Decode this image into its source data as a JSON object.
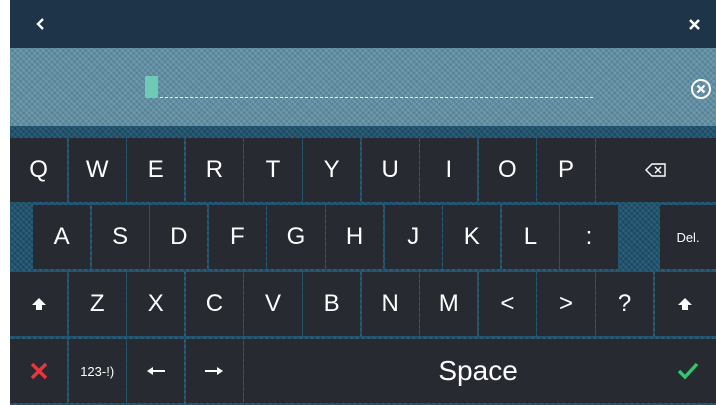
{
  "header": {
    "back_icon": "chevron-left-icon",
    "close_icon": "close-icon"
  },
  "input": {
    "value": "",
    "clear_icon": "clear-circle-icon"
  },
  "keyboard": {
    "row1": [
      "Q",
      "W",
      "E",
      "R",
      "T",
      "Y",
      "U",
      "I",
      "O",
      "P"
    ],
    "row2": [
      "A",
      "S",
      "D",
      "F",
      "G",
      "H",
      "J",
      "K",
      "L",
      ":"
    ],
    "row3": [
      "Z",
      "X",
      "C",
      "V",
      "B",
      "N",
      "M",
      "<",
      ">",
      "?"
    ],
    "delete_label": "Del.",
    "numbers_label": "123-!)",
    "space_label": "Space",
    "backspace_icon": "backspace-icon",
    "shift_icon": "shift-icon",
    "cancel_icon": "cancel-x-icon",
    "left_arrow_icon": "arrow-left-icon",
    "right_arrow_icon": "arrow-right-icon",
    "confirm_icon": "checkmark-icon"
  },
  "colors": {
    "header_bg": "#1e3448",
    "input_bg": "#5f8ea3",
    "key_bg": "#272b31",
    "cursor": "#6ec9b6",
    "cancel": "#e8373a",
    "confirm": "#35c46b"
  }
}
